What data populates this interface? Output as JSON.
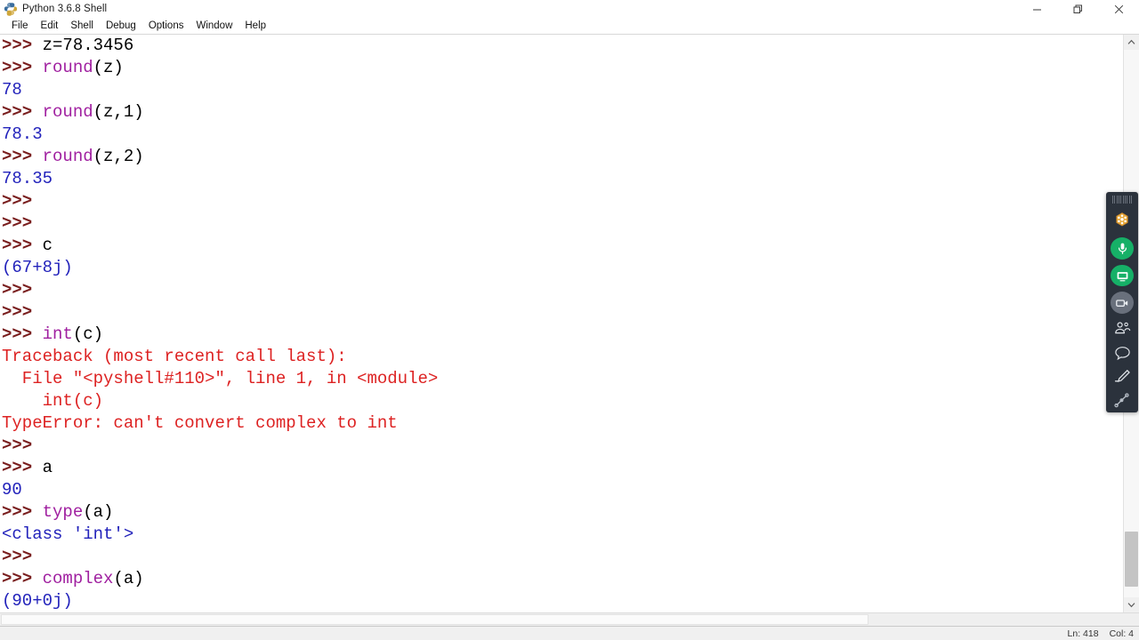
{
  "window": {
    "title": "Python 3.6.8 Shell",
    "icon": "python-idle-icon",
    "controls": [
      {
        "name": "minimize-button",
        "glyph": "minimize"
      },
      {
        "name": "restore-button",
        "glyph": "restore"
      },
      {
        "name": "close-button",
        "glyph": "close"
      }
    ]
  },
  "menu": {
    "items": [
      {
        "label": "File"
      },
      {
        "label": "Edit"
      },
      {
        "label": "Shell"
      },
      {
        "label": "Debug"
      },
      {
        "label": "Options"
      },
      {
        "label": "Window"
      },
      {
        "label": "Help"
      }
    ]
  },
  "shell": {
    "lines": [
      {
        "segments": [
          {
            "text": ">>> ",
            "style": "prompt"
          },
          {
            "text": "z=78.3456",
            "style": "plain"
          }
        ]
      },
      {
        "segments": [
          {
            "text": ">>> ",
            "style": "prompt"
          },
          {
            "text": "round",
            "style": "builtin"
          },
          {
            "text": "(z)",
            "style": "plain"
          }
        ]
      },
      {
        "segments": [
          {
            "text": "78",
            "style": "out"
          }
        ]
      },
      {
        "segments": [
          {
            "text": ">>> ",
            "style": "prompt"
          },
          {
            "text": "round",
            "style": "builtin"
          },
          {
            "text": "(z,1)",
            "style": "plain"
          }
        ]
      },
      {
        "segments": [
          {
            "text": "78.3",
            "style": "out"
          }
        ]
      },
      {
        "segments": [
          {
            "text": ">>> ",
            "style": "prompt"
          },
          {
            "text": "round",
            "style": "builtin"
          },
          {
            "text": "(z,2)",
            "style": "plain"
          }
        ]
      },
      {
        "segments": [
          {
            "text": "78.35",
            "style": "out"
          }
        ]
      },
      {
        "segments": [
          {
            "text": ">>> ",
            "style": "prompt"
          }
        ]
      },
      {
        "segments": [
          {
            "text": ">>> ",
            "style": "prompt"
          }
        ]
      },
      {
        "segments": [
          {
            "text": ">>> ",
            "style": "prompt"
          },
          {
            "text": "c",
            "style": "plain"
          }
        ]
      },
      {
        "segments": [
          {
            "text": "(67+8j)",
            "style": "out"
          }
        ]
      },
      {
        "segments": [
          {
            "text": ">>> ",
            "style": "prompt"
          }
        ]
      },
      {
        "segments": [
          {
            "text": ">>> ",
            "style": "prompt"
          }
        ]
      },
      {
        "segments": [
          {
            "text": ">>> ",
            "style": "prompt"
          },
          {
            "text": "int",
            "style": "builtin"
          },
          {
            "text": "(c)",
            "style": "plain"
          }
        ]
      },
      {
        "segments": [
          {
            "text": "Traceback (most recent call last):",
            "style": "err"
          }
        ]
      },
      {
        "segments": [
          {
            "text": "  File \"<pyshell#110>\", line 1, in <module>",
            "style": "err"
          }
        ]
      },
      {
        "segments": [
          {
            "text": "    int(c)",
            "style": "err"
          }
        ]
      },
      {
        "segments": [
          {
            "text": "TypeError: can't convert complex to int",
            "style": "err"
          }
        ]
      },
      {
        "segments": [
          {
            "text": ">>> ",
            "style": "prompt"
          }
        ]
      },
      {
        "segments": [
          {
            "text": ">>> ",
            "style": "prompt"
          },
          {
            "text": "a",
            "style": "plain"
          }
        ]
      },
      {
        "segments": [
          {
            "text": "90",
            "style": "out"
          }
        ]
      },
      {
        "segments": [
          {
            "text": ">>> ",
            "style": "prompt"
          },
          {
            "text": "type",
            "style": "builtin"
          },
          {
            "text": "(a)",
            "style": "plain"
          }
        ]
      },
      {
        "segments": [
          {
            "text": "<class 'int'>",
            "style": "out"
          }
        ]
      },
      {
        "segments": [
          {
            "text": ">>> ",
            "style": "prompt"
          }
        ]
      },
      {
        "segments": [
          {
            "text": ">>> ",
            "style": "prompt"
          },
          {
            "text": "complex",
            "style": "builtin"
          },
          {
            "text": "(a)",
            "style": "plain"
          }
        ]
      },
      {
        "segments": [
          {
            "text": "(90+0j)",
            "style": "out"
          }
        ]
      },
      {
        "segments": [
          {
            "text": ">>> ",
            "style": "prompt"
          }
        ],
        "caret": true
      }
    ],
    "colors": {
      "prompt": "#7a1f1f",
      "builtin": "#a020a0",
      "output": "#2222bb",
      "error": "#dd2222",
      "plain": "#000000",
      "background": "#ffffff"
    }
  },
  "status": {
    "line_label": "Ln: 418",
    "col_label": "Col: 4"
  },
  "scrollbars": {
    "vertical": {
      "up_glyph": "chevron-up",
      "down_glyph": "chevron-down"
    },
    "horizontal": {
      "present": true
    }
  },
  "meeting_toolbar": {
    "accent_green": "#16b067",
    "accent_gray": "#69707c",
    "background": "#2b323c",
    "items": [
      {
        "name": "drag-handle",
        "kind": "handle"
      },
      {
        "name": "app-logo-icon",
        "kind": "logo"
      },
      {
        "name": "microphone-button",
        "kind": "circle-green"
      },
      {
        "name": "share-screen-button",
        "kind": "circle-green"
      },
      {
        "name": "camera-button",
        "kind": "circle-gray"
      },
      {
        "name": "participants-icon",
        "kind": "plain"
      },
      {
        "name": "chat-icon",
        "kind": "plain"
      },
      {
        "name": "pencil-icon",
        "kind": "plain"
      },
      {
        "name": "pointer-share-icon",
        "kind": "plain"
      }
    ]
  }
}
